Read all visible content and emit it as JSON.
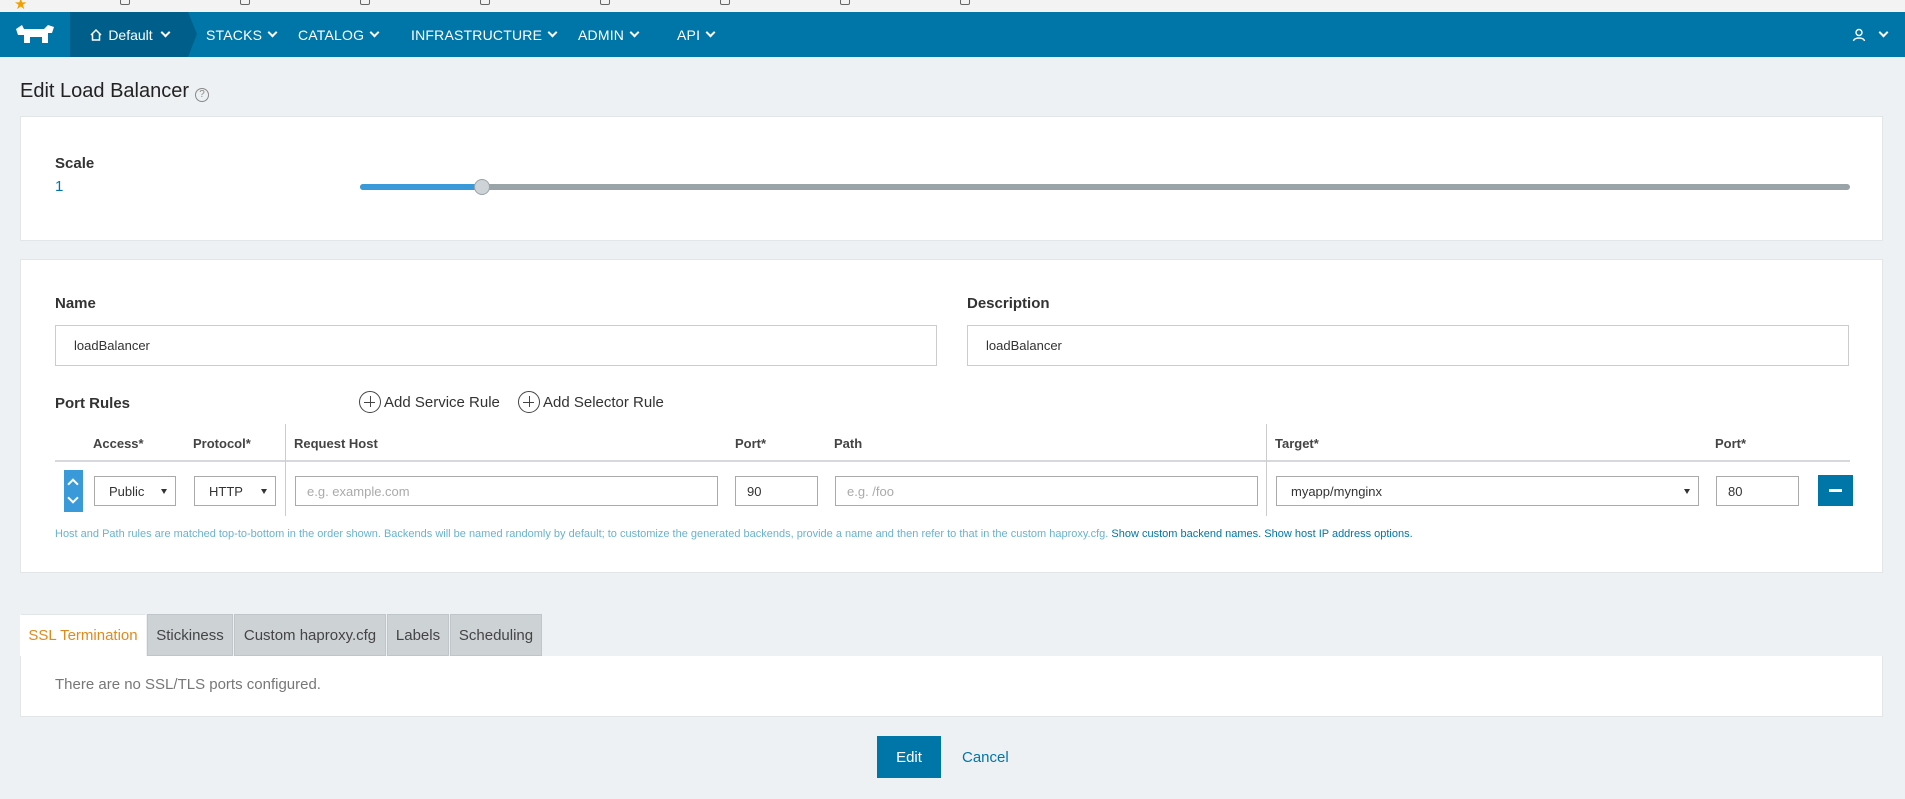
{
  "nav": {
    "environment": "Default",
    "items": [
      "STACKS",
      "CATALOG",
      "INFRASTRUCTURE",
      "ADMIN",
      "API"
    ]
  },
  "page": {
    "title": "Edit Load Balancer"
  },
  "scale": {
    "label": "Scale",
    "value": "1",
    "slider_fraction": 0.082
  },
  "form": {
    "name_label": "Name",
    "name_value": "loadBalancer",
    "description_label": "Description",
    "description_value": "loadBalancer"
  },
  "port_rules": {
    "label": "Port Rules",
    "add_service_rule": "Add Service Rule",
    "add_selector_rule": "Add Selector Rule",
    "headers": {
      "access": "Access*",
      "protocol": "Protocol*",
      "request_host": "Request Host",
      "port": "Port*",
      "path": "Path",
      "target": "Target*",
      "target_port": "Port*"
    },
    "rows": [
      {
        "access": "Public",
        "protocol": "HTTP",
        "request_host_placeholder": "e.g. example.com",
        "port": "90",
        "path_placeholder": "e.g. /foo",
        "target": "myapp/mynginx",
        "target_port": "80"
      }
    ],
    "help_text": "Host and Path rules are matched top-to-bottom in the order shown. Backends will be named randomly by default; to customize the generated backends, provide a name and then refer to that in the custom haproxy.cfg.",
    "show_backend_names": "Show custom backend names.",
    "show_host_ip": "Show host IP address options."
  },
  "tabs": [
    "SSL Termination",
    "Stickiness",
    "Custom haproxy.cfg",
    "Labels",
    "Scheduling"
  ],
  "ssl": {
    "empty_message": "There are no SSL/TLS ports configured."
  },
  "actions": {
    "edit": "Edit",
    "cancel": "Cancel"
  },
  "colors": {
    "nav_bg": "#0075a8",
    "accent": "#3a9ad9",
    "active_tab": "#e08a1c"
  }
}
